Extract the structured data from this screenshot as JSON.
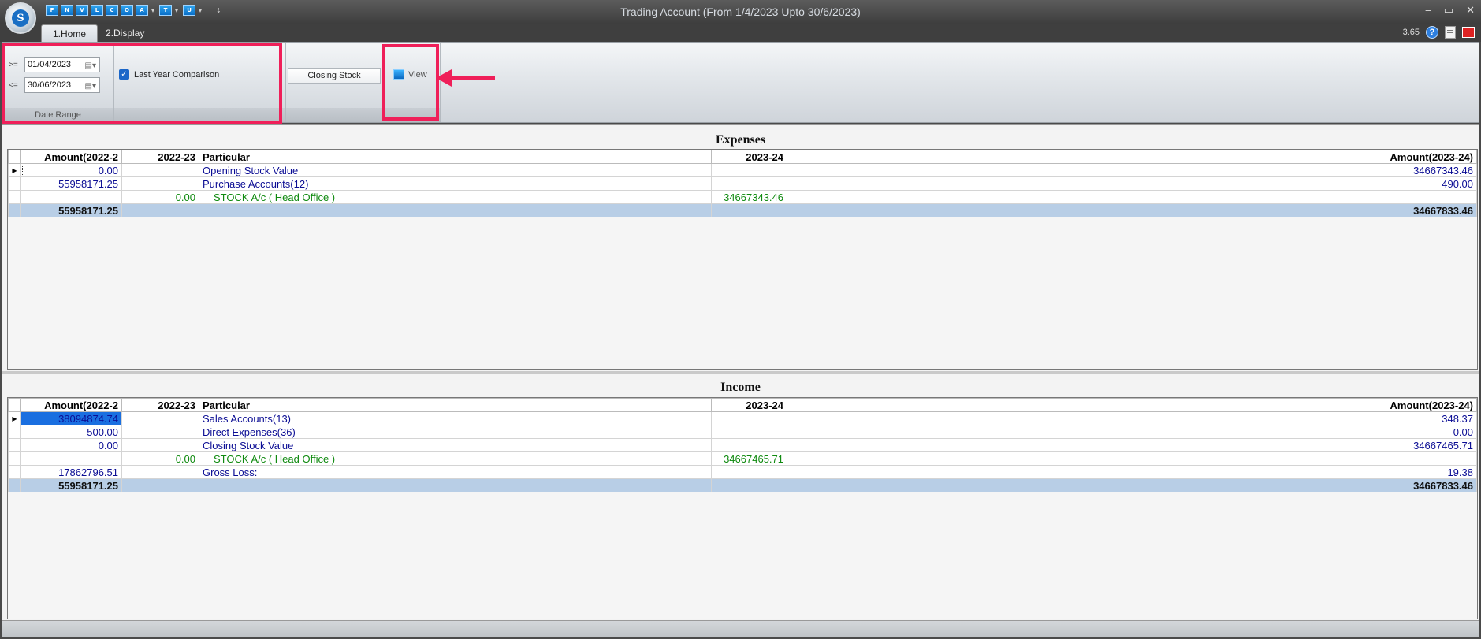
{
  "window": {
    "title": "Trading Account (From 1/4/2023 Upto 30/6/2023)",
    "minimize": "–",
    "maximize": "▭",
    "close": "✕",
    "version": "3.65"
  },
  "app_logo": "S",
  "quick_access": [
    "F",
    "N",
    "V",
    "L",
    "C",
    "O",
    "A",
    "T",
    "U"
  ],
  "tabs": [
    {
      "label": "1.Home",
      "active": true
    },
    {
      "label": "2.Display",
      "active": false
    }
  ],
  "ribbon": {
    "date_range": {
      "from_op": ">=",
      "from_value": "01/04/2023",
      "to_op": "<=",
      "to_value": "30/06/2023",
      "group_label": "Date Range"
    },
    "last_year_comparison": {
      "label": "Last Year Comparison",
      "checked": true
    },
    "closing_stock_label": "Closing Stock",
    "view_label": "View"
  },
  "expenses": {
    "title": "Expenses",
    "columns": [
      "Amount(2022-2",
      "2022-23",
      "Particular",
      "2023-24",
      "Amount(2023-24)"
    ],
    "rows": [
      {
        "amount_prev": "0.00",
        "sub_prev": "",
        "particular": "Opening Stock Value",
        "sub_curr": "",
        "amount_curr": "34667343.46",
        "type": "main"
      },
      {
        "amount_prev": "55958171.25",
        "sub_prev": "",
        "particular": "Purchase Accounts(12)",
        "sub_curr": "",
        "amount_curr": "490.00",
        "type": "main"
      },
      {
        "amount_prev": "",
        "sub_prev": "0.00",
        "particular": "STOCK A/c ( Head Office )",
        "sub_curr": "34667343.46",
        "amount_curr": "",
        "type": "sub"
      }
    ],
    "total": {
      "amount_prev": "55958171.25",
      "amount_curr": "34667833.46"
    }
  },
  "income": {
    "title": "Income",
    "columns": [
      "Amount(2022-2",
      "2022-23",
      "Particular",
      "2023-24",
      "Amount(2023-24)"
    ],
    "rows": [
      {
        "amount_prev": "38094874.74",
        "sub_prev": "",
        "particular": "Sales Accounts(13)",
        "sub_curr": "",
        "amount_curr": "348.37",
        "type": "main"
      },
      {
        "amount_prev": "500.00",
        "sub_prev": "",
        "particular": "Direct Expenses(36)",
        "sub_curr": "",
        "amount_curr": "0.00",
        "type": "main"
      },
      {
        "amount_prev": "0.00",
        "sub_prev": "",
        "particular": "Closing Stock Value",
        "sub_curr": "",
        "amount_curr": "34667465.71",
        "type": "main"
      },
      {
        "amount_prev": "",
        "sub_prev": "0.00",
        "particular": "STOCK A/c ( Head Office )",
        "sub_curr": "34667465.71",
        "amount_curr": "",
        "type": "sub"
      },
      {
        "amount_prev": "17862796.51",
        "sub_prev": "",
        "particular": "Gross Loss:",
        "sub_curr": "",
        "amount_curr": "19.38",
        "type": "main"
      }
    ],
    "total": {
      "amount_prev": "55958171.25",
      "amount_curr": "34667833.46"
    }
  },
  "colors": {
    "highlight": "#ef1f59",
    "main_text": "#0b0d94",
    "sub_text": "#0f8a0f",
    "total_row": "#b8cee6",
    "selected_cell": "#1a6fe0"
  }
}
